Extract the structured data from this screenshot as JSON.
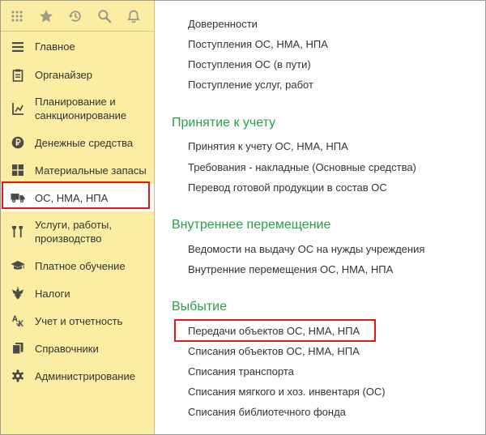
{
  "toolbar": {
    "buttons": [
      {
        "icon": "apps-grid-icon"
      },
      {
        "icon": "star-icon"
      },
      {
        "icon": "history-icon"
      },
      {
        "icon": "search-icon"
      },
      {
        "icon": "bell-icon"
      }
    ]
  },
  "sidebar": {
    "items": [
      {
        "label": "Главное",
        "icon": "menu-lines-icon"
      },
      {
        "label": "Органайзер",
        "icon": "notepad-icon"
      },
      {
        "label": "Планирование и\nсанкционирование",
        "icon": "planning-icon"
      },
      {
        "label": "Денежные средства",
        "icon": "ruble-coin-icon"
      },
      {
        "label": "Материальные запасы",
        "icon": "grid-blocks-icon"
      },
      {
        "label": "ОС, НМА, НПА",
        "icon": "truck-icon",
        "selected": true
      },
      {
        "label": "Услуги, работы,\nпроизводство",
        "icon": "tools-icon"
      },
      {
        "label": "Платное обучение",
        "icon": "graduation-cap-icon"
      },
      {
        "label": "Налоги",
        "icon": "eagle-emblem-icon"
      },
      {
        "label": "Учет и отчетность",
        "icon": "accounting-icon"
      },
      {
        "label": "Справочники",
        "icon": "books-icon"
      },
      {
        "label": "Администрирование",
        "icon": "gear-icon"
      }
    ]
  },
  "content": {
    "top_links": [
      "Доверенности",
      "Поступления ОС, НМА, НПА",
      "Поступления ОС (в пути)",
      "Поступление услуг, работ"
    ],
    "sections": [
      {
        "title": "Принятие к учету",
        "links": [
          "Принятия к учету ОС, НМА, НПА",
          "Требования - накладные (Основные средства)",
          "Перевод готовой продукции в состав ОС"
        ]
      },
      {
        "title": "Внутреннее перемещение",
        "links": [
          "Ведомости на выдачу ОС на нужды учреждения",
          "Внутренние перемещения ОС, НМА, НПА"
        ]
      },
      {
        "title": "Выбытие",
        "links": [
          "Передачи объектов ОС, НМА, НПА",
          "Списания объектов ОС, НМА, НПА",
          "Списания транспорта",
          "Списания мягкого и хоз. инвентаря (ОС)",
          "Списания библиотечного фонда"
        ]
      }
    ]
  },
  "colors": {
    "sidebar_bg": "#fbeda1",
    "section_title": "#27a04a",
    "highlight": "#e0191b"
  }
}
